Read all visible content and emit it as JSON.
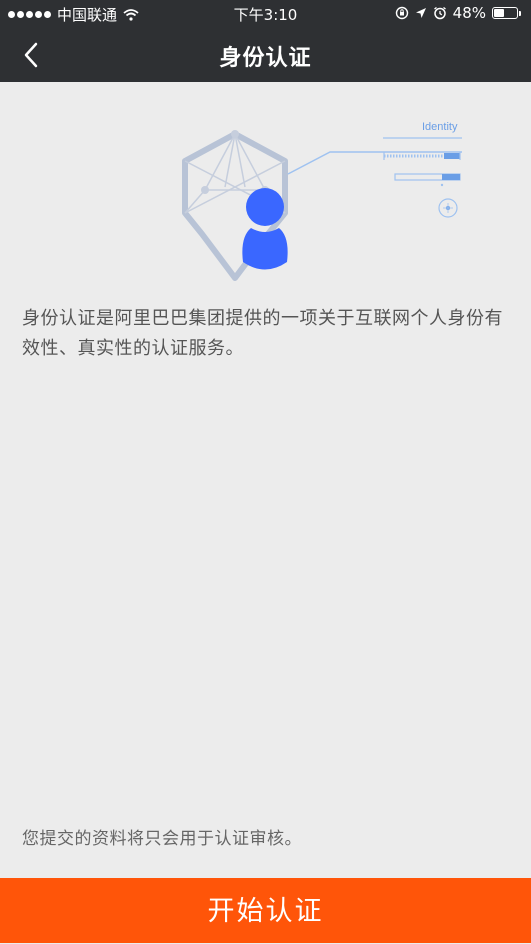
{
  "status_bar": {
    "carrier": "中国联通",
    "time": "下午3:10",
    "battery_percent": "48%",
    "battery_level": 0.48,
    "icons": [
      "signal-dots-icon",
      "wifi-icon",
      "rotation-lock-icon",
      "location-arrow-icon",
      "alarm-icon",
      "battery-icon"
    ]
  },
  "header": {
    "title": "身份认证",
    "back_icon": "chevron-left-icon"
  },
  "illustration": {
    "label": "Identity",
    "accent": "#3a67ff"
  },
  "main": {
    "description": "身份认证是阿里巴巴集团提供的一项关于互联网个人身份有效性、真实性的认证服务。",
    "footnote": "您提交的资料将只会用于认证审核。"
  },
  "footer": {
    "start_label": "开始认证"
  },
  "colors": {
    "header_bg": "#2e3033",
    "page_bg": "#ececec",
    "primary_button": "#ff5509",
    "avatar_blue": "#3a67ff"
  }
}
